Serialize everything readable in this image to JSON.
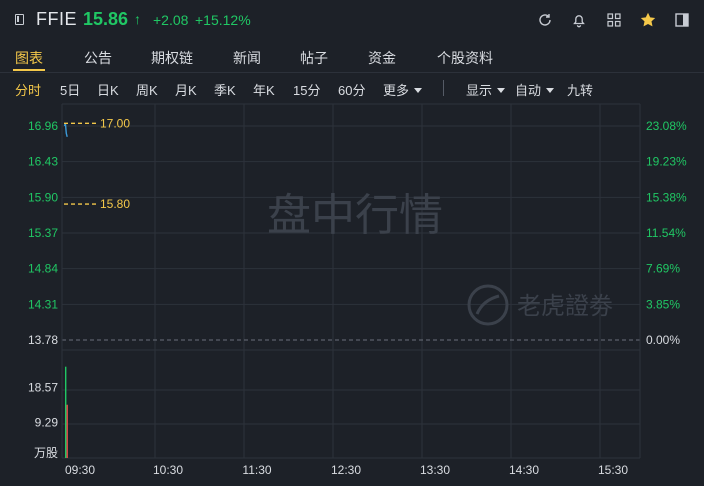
{
  "header": {
    "ticker": "FFIE",
    "price": "15.86",
    "arrow": "↑",
    "change": "+2.08",
    "change_pct": "+15.12%",
    "icons": [
      "symbol-list-icon",
      "refresh-icon",
      "bell-icon",
      "grid-icon",
      "star-icon",
      "panel-icon"
    ],
    "up_color": "#20c764",
    "accent_color": "#f4c84a"
  },
  "tabs": [
    {
      "label": "图表"
    },
    {
      "label": "公告"
    },
    {
      "label": "期权链"
    },
    {
      "label": "新闻"
    },
    {
      "label": "帖子"
    },
    {
      "label": "资金"
    },
    {
      "label": "个股资料"
    }
  ],
  "active_tab": "图表",
  "periods": [
    {
      "label": "分时"
    },
    {
      "label": "5日"
    },
    {
      "label": "日K"
    },
    {
      "label": "周K"
    },
    {
      "label": "月K"
    },
    {
      "label": "季K"
    },
    {
      "label": "年K"
    },
    {
      "label": "15分"
    },
    {
      "label": "60分"
    }
  ],
  "active_period": "分时",
  "period_more": "更多",
  "toolbar": {
    "display": "显示",
    "auto": "自动",
    "adjust": "九转"
  },
  "watermark": {
    "text": "盘中行情",
    "brand": "老虎證劵"
  },
  "chart_data": {
    "type": "line",
    "title": "",
    "x_ticks": [
      "09:30",
      "10:30",
      "11:30",
      "12:30",
      "13:30",
      "14:30",
      "15:30"
    ],
    "y_ticks": [
      "16.96",
      "16.43",
      "15.90",
      "15.37",
      "14.84",
      "14.31",
      "13.78"
    ],
    "y_pct_ticks": [
      "23.08%",
      "19.23%",
      "15.38%",
      "11.54%",
      "7.69%",
      "3.85%",
      "0.00%"
    ],
    "ylim": [
      13.78,
      16.96
    ],
    "prev_close": 13.78,
    "series": [
      {
        "x": [
          "09:30",
          "09:30",
          "09:30",
          "09:31"
        ],
        "y": [
          16.96,
          17.0,
          16.85,
          16.8
        ]
      }
    ],
    "annotations": [
      {
        "label": "17.00",
        "value": 17.0
      },
      {
        "label": "15.80",
        "value": 15.8
      }
    ],
    "volume": {
      "unit": "万股",
      "y_ticks": [
        "18.57",
        "9.29"
      ],
      "ylim": [
        0,
        27.86
      ],
      "bars": [
        {
          "x": "09:30",
          "value": 24.0,
          "dir": "up"
        },
        {
          "x": "09:31",
          "value": 14.0,
          "dir": "down"
        }
      ]
    },
    "grid": true
  }
}
